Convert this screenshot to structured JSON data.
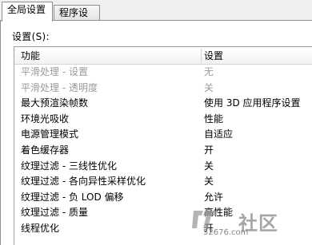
{
  "tabs": [
    {
      "label": "全局设置",
      "active": true
    },
    {
      "label": "程序设置",
      "active": false
    }
  ],
  "settings_label": "设置(S):",
  "columns": {
    "feature": "功能",
    "setting": "设置"
  },
  "rows": [
    {
      "feature": "平滑处理 - 设置",
      "value": "无",
      "disabled": true
    },
    {
      "feature": "平滑处理 - 透明度",
      "value": "关",
      "disabled": true
    },
    {
      "feature": "最大预渲染帧数",
      "value": "使用 3D 应用程序设置",
      "disabled": false
    },
    {
      "feature": "环境光吸收",
      "value": "性能",
      "disabled": false
    },
    {
      "feature": "电源管理模式",
      "value": "自适应",
      "disabled": false
    },
    {
      "feature": "着色缓存器",
      "value": "开",
      "disabled": false
    },
    {
      "feature": "纹理过滤 - 三线性优化",
      "value": "关",
      "disabled": false
    },
    {
      "feature": "纹理过滤 - 各向异性采样优化",
      "value": "关",
      "disabled": false
    },
    {
      "feature": "纹理过滤 - 负 LOD 偏移",
      "value": "允许",
      "disabled": false
    },
    {
      "feature": "纹理过滤 - 质量",
      "value": "高性能",
      "disabled": false
    },
    {
      "feature": "线程优化",
      "value": "开",
      "disabled": false
    }
  ],
  "watermark": {
    "main": "社区",
    "sub": "52676.com"
  },
  "colors": {
    "disabled_text": "#9a9a9a",
    "border": "#8e8f8f"
  }
}
